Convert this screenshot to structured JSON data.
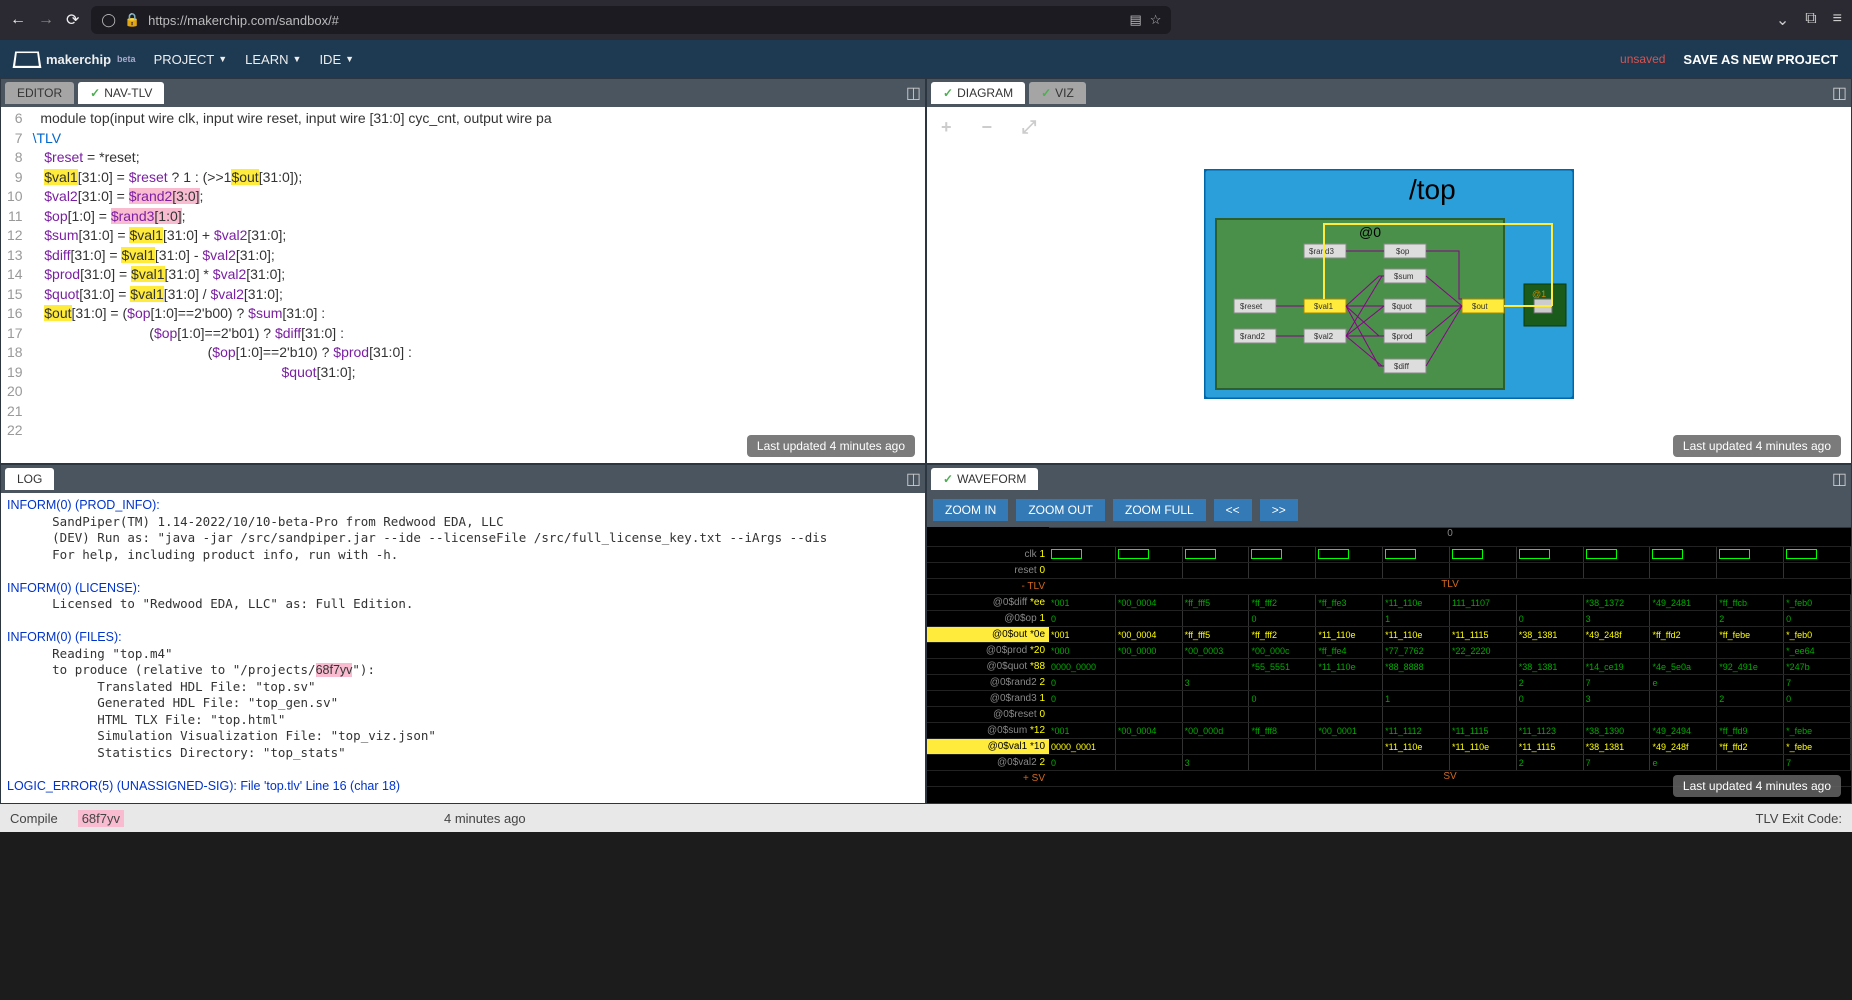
{
  "browser": {
    "url": "https://makerchip.com/sandbox/#"
  },
  "app": {
    "logo": "makerchip",
    "beta": "beta",
    "menus": [
      "PROJECT",
      "LEARN",
      "IDE"
    ],
    "unsaved": "unsaved",
    "save": "SAVE AS NEW PROJECT"
  },
  "editor": {
    "tabs": {
      "editor": "EDITOR",
      "navtlv": "NAV-TLV"
    },
    "last_updated": "Last updated 4 minutes ago",
    "gutter_start": 6,
    "lines": [
      {
        "n": 6,
        "raw": "  module top(input wire clk, input wire reset, input wire [31:0] cyc_cnt, output wire pa"
      },
      {
        "n": 7,
        "raw": "\\TLV",
        "cls": "kw"
      },
      {
        "n": 8,
        "raw": "   $reset = *reset;"
      },
      {
        "n": 9,
        "raw": "   $val1[31:0] = $reset ? 1 : (>>1$out[31:0]);",
        "hl": {
          "val1": true,
          "out": true
        }
      },
      {
        "n": 10,
        "raw": "   $val2[31:0] = $rand2[3:0];",
        "pink": "rand2"
      },
      {
        "n": 11,
        "raw": "   $op[1:0] = $rand3[1:0];",
        "pink": "rand3"
      },
      {
        "n": 12,
        "raw": ""
      },
      {
        "n": 13,
        "raw": "   $sum[31:0] = $val1[31:0] + $val2[31:0];",
        "hl": {
          "val1": true
        }
      },
      {
        "n": 14,
        "raw": "   $diff[31:0] = $val1[31:0] - $val2[31:0];",
        "hl": {
          "val1": true
        }
      },
      {
        "n": 15,
        "raw": "   $prod[31:0] = $val1[31:0] * $val2[31:0];",
        "hl": {
          "val1": true
        }
      },
      {
        "n": 16,
        "raw": "   $quot[31:0] = $val1[31:0] / $val2[31:0];",
        "hl": {
          "val1": true
        }
      },
      {
        "n": 17,
        "raw": ""
      },
      {
        "n": 18,
        "raw": "   $out[31:0] = ($op[1:0]==2'b00) ? $sum[31:0] :",
        "hl": {
          "out": true
        }
      },
      {
        "n": 19,
        "raw": "                              ($op[1:0]==2'b01) ? $diff[31:0] :"
      },
      {
        "n": 20,
        "raw": "                                             ($op[1:0]==2'b10) ? $prod[31:0] :"
      },
      {
        "n": 21,
        "raw": "                                                                $quot[31:0];"
      },
      {
        "n": 22,
        "raw": ""
      }
    ]
  },
  "diagram": {
    "tabs": {
      "diagram": "DIAGRAM",
      "viz": "VIZ"
    },
    "title": "/top",
    "stage": "@0",
    "stage1": "@1",
    "nodes": [
      "$rand3",
      "$op",
      "$sum",
      "$reset",
      "$val1",
      "$quot",
      "$out",
      "$rand2",
      "$val2",
      "$prod",
      "$diff"
    ],
    "last_updated": "Last updated 4 minutes ago"
  },
  "log": {
    "tab": "LOG",
    "lines": [
      "INFORM(0) (PROD_INFO):",
      "      SandPiper(TM) 1.14-2022/10/10-beta-Pro from Redwood EDA, LLC",
      "      (DEV) Run as: \"java -jar /src/sandpiper.jar --ide --licenseFile /src/full_license_key.txt --iArgs --dis",
      "      For help, including product info, run with -h.",
      "",
      "INFORM(0) (LICENSE):",
      "      Licensed to \"Redwood EDA, LLC\" as: Full Edition.",
      "",
      "INFORM(0) (FILES):",
      "      Reading \"top.m4\"",
      "      to produce (relative to \"/projects/68f7yv\"):",
      "            Translated HDL File: \"top.sv\"",
      "            Generated HDL File: \"top_gen.sv\"",
      "            HTML TLX File: \"top.html\"",
      "            Simulation Visualization File: \"top_viz.json\"",
      "            Statistics Directory: \"top_stats\"",
      "",
      "LOGIC_ERROR(5) (UNASSIGNED-SIG): File 'top.tlv' Line 16 (char 18)"
    ]
  },
  "waveform": {
    "tab": "WAVEFORM",
    "buttons": [
      "ZOOM IN",
      "ZOOM OUT",
      "ZOOM FULL",
      "<<",
      ">>"
    ],
    "signals": [
      {
        "name": "clk",
        "val": "1"
      },
      {
        "name": "reset",
        "val": "0"
      },
      {
        "name": "- TLV",
        "val": "",
        "orange": true,
        "center": "TLV"
      },
      {
        "name": "@0$diff",
        "val": "*ee",
        "row": [
          "*001",
          "*00_0004",
          "*ff_fff5",
          "*ff_fff2",
          "*ff_ffe3",
          "*11_110e",
          "111_1107",
          "",
          "*38_1372",
          "*49_2481",
          "*ff_ffcb",
          "*_feb0"
        ]
      },
      {
        "name": "@0$op",
        "val": "1",
        "row": [
          "0",
          "",
          "",
          "0",
          "",
          "1",
          "",
          "0",
          "3",
          "",
          "2",
          "0"
        ]
      },
      {
        "name": "@0$out",
        "val": "*0e",
        "hl": true,
        "row": [
          "*001",
          "*00_0004",
          "*ff_fff5",
          "*ff_fff2",
          "*11_110e",
          "*11_110e",
          "*11_1115",
          "*38_1381",
          "*49_248f",
          "*ff_ffd2",
          "*ff_febe",
          "*_feb0"
        ]
      },
      {
        "name": "@0$prod",
        "val": "*20",
        "row": [
          "*000",
          "*00_0000",
          "*00_0003",
          "*00_000c",
          "*ff_ffe4",
          "*77_7762",
          "*22_2220",
          "",
          "",
          "",
          "",
          "*_ee64"
        ]
      },
      {
        "name": "@0$quot",
        "val": "*88",
        "row": [
          "0000_0000",
          "",
          "",
          "*55_5551",
          "*11_110e",
          "*88_8888",
          "",
          "*38_1381",
          "*14_ce19",
          "*4e_5e0a",
          "*92_491e",
          "*247b"
        ]
      },
      {
        "name": "@0$rand2",
        "val": "2",
        "row": [
          "0",
          "",
          "3",
          "",
          "",
          "",
          "",
          "2",
          "7",
          "e",
          "",
          "7"
        ]
      },
      {
        "name": "@0$rand3",
        "val": "1",
        "row": [
          "0",
          "",
          "",
          "0",
          "",
          "1",
          "",
          "0",
          "3",
          "",
          "2",
          "0"
        ]
      },
      {
        "name": "@0$reset",
        "val": "0",
        "row": [
          "",
          "",
          "",
          "",
          "",
          "",
          "",
          "",
          "",
          "",
          "",
          ""
        ]
      },
      {
        "name": "@0$sum",
        "val": "*12",
        "row": [
          "*001",
          "*00_0004",
          "*00_000d",
          "*ff_fff8",
          "*00_0001",
          "*11_1112",
          "*11_1115",
          "*11_1123",
          "*38_1390",
          "*49_2494",
          "*ff_ffd9",
          "*_febe"
        ]
      },
      {
        "name": "@0$val1",
        "val": "*10",
        "hl": true,
        "row": [
          "0000_0001",
          "",
          "",
          "",
          "",
          "*11_110e",
          "*11_110e",
          "*11_1115",
          "*38_1381",
          "*49_248f",
          "*ff_ffd2",
          "*_febe"
        ]
      },
      {
        "name": "@0$val2",
        "val": "2",
        "row": [
          "0",
          "",
          "3",
          "",
          "",
          "",
          "",
          "2",
          "7",
          "e",
          "",
          "7"
        ]
      },
      {
        "name": "+ SV",
        "val": "",
        "orange": true,
        "center": "SV"
      }
    ],
    "last_updated": "Last updated 4 minutes ago"
  },
  "status": {
    "compile": "Compile",
    "hash": "68f7yv",
    "time": "4 minutes ago",
    "exit": "TLV Exit Code:"
  }
}
